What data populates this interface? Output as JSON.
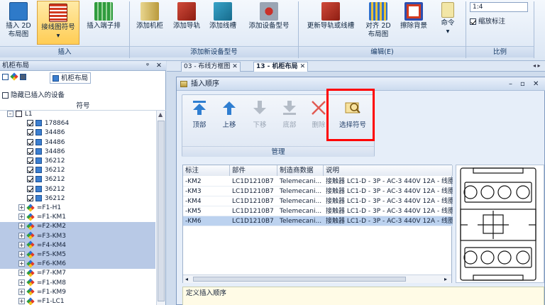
{
  "ribbon": {
    "buttons": [
      {
        "label1": "插入 2D",
        "label2": "布局图"
      },
      {
        "label1": "接线图符号",
        "label2": "▾"
      },
      {
        "label1": "插入端子排",
        "label2": ""
      },
      {
        "label1": "添加机柜",
        "label2": ""
      },
      {
        "label1": "添加导轨",
        "label2": ""
      },
      {
        "label1": "添加线槽",
        "label2": ""
      },
      {
        "label1": "添加设备型号",
        "label2": ""
      },
      {
        "label1": "更新导轨或线槽",
        "label2": ""
      },
      {
        "label1": "对齐 2D",
        "label2": "布局图"
      },
      {
        "label1": "擦除背景",
        "label2": ""
      },
      {
        "label1": "命令",
        "label2": "▾"
      }
    ],
    "groups": [
      "插入",
      "添加新设备型号",
      "编辑(E)",
      "比例"
    ],
    "scale_value": "1:4",
    "scale_check_label": "缩放标注"
  },
  "left_panel": {
    "title": "机柜布局",
    "pin": "ᵠ",
    "close": "✕",
    "tab_label": "机柜布局",
    "hide_inserted_label": "隐藏已插入的设备",
    "column_header": "符号",
    "root_label": "L1",
    "children": [
      "178864",
      "34486",
      "34486",
      "34486",
      "36212",
      "36212",
      "36212",
      "36212",
      "36212"
    ],
    "devices": [
      "=F1-H1",
      "=F1-KM1",
      "=F2-KM2",
      "=F3-KM3",
      "=F4-KM4",
      "=F5-KM5",
      "=F6-KM6",
      "=F7-KM7",
      "=F1-KM8",
      "=F1-KM9",
      "=F1-LC1"
    ],
    "highlighted": [
      2,
      3,
      4,
      5,
      6
    ]
  },
  "doc_tabs": [
    "03 - 布线方框图",
    "13 - 机柜布局"
  ],
  "dialog": {
    "title": "插入顺序",
    "toolbar": [
      {
        "label": "顶部",
        "enabled": true
      },
      {
        "label": "上移",
        "enabled": true
      },
      {
        "label": "下移",
        "enabled": false
      },
      {
        "label": "底部",
        "enabled": false
      },
      {
        "label": "删除",
        "enabled": false
      },
      {
        "label": "选择符号",
        "enabled": true
      }
    ],
    "group_label": "管理",
    "columns": [
      "标注",
      "部件",
      "制造商数据",
      "说明"
    ],
    "rows": [
      {
        "tag": "-KM2",
        "part": "LC1D1210B7",
        "maker": "Telemecani...",
        "desc": "接触器 LC1-D - 3P - AC-3 440V 12A - 线圈"
      },
      {
        "tag": "-KM3",
        "part": "LC1D1210B7",
        "maker": "Telemecani...",
        "desc": "接触器 LC1-D - 3P - AC-3 440V 12A - 线圈"
      },
      {
        "tag": "-KM4",
        "part": "LC1D1210B7",
        "maker": "Telemecani...",
        "desc": "接触器 LC1-D - 3P - AC-3 440V 12A - 线圈"
      },
      {
        "tag": "-KM5",
        "part": "LC1D1210B7",
        "maker": "Telemecani...",
        "desc": "接触器 LC1-D - 3P - AC-3 440V 12A - 线圈"
      },
      {
        "tag": "-KM6",
        "part": "LC1D1210B7",
        "maker": "Telemecani...",
        "desc": "接触器 LC1-D - 3P - AC-3 440V 12A - 线圈"
      }
    ],
    "selected_row": 4,
    "footer_label": "定义插入顺序"
  },
  "colors": {
    "highlight": "#ff0000",
    "selected_row": "#bcd2ef"
  }
}
